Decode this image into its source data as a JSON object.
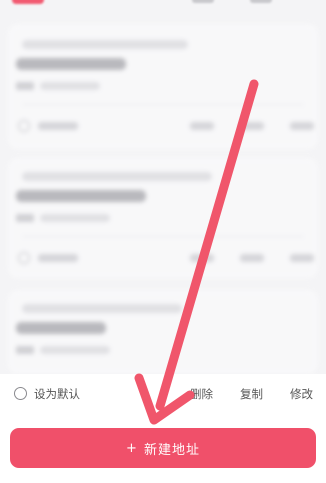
{
  "address_item": {
    "default_label": "设为默认",
    "delete_label": "删除",
    "copy_label": "复制",
    "edit_label": "修改"
  },
  "new_address_button": {
    "icon": "+",
    "label": "新建地址"
  },
  "colors": {
    "accent": "#f0506a",
    "arrow": "#f0566b",
    "background": "#f4f4f6"
  },
  "annotation": {
    "icon": "arrow-down-left-icon"
  }
}
